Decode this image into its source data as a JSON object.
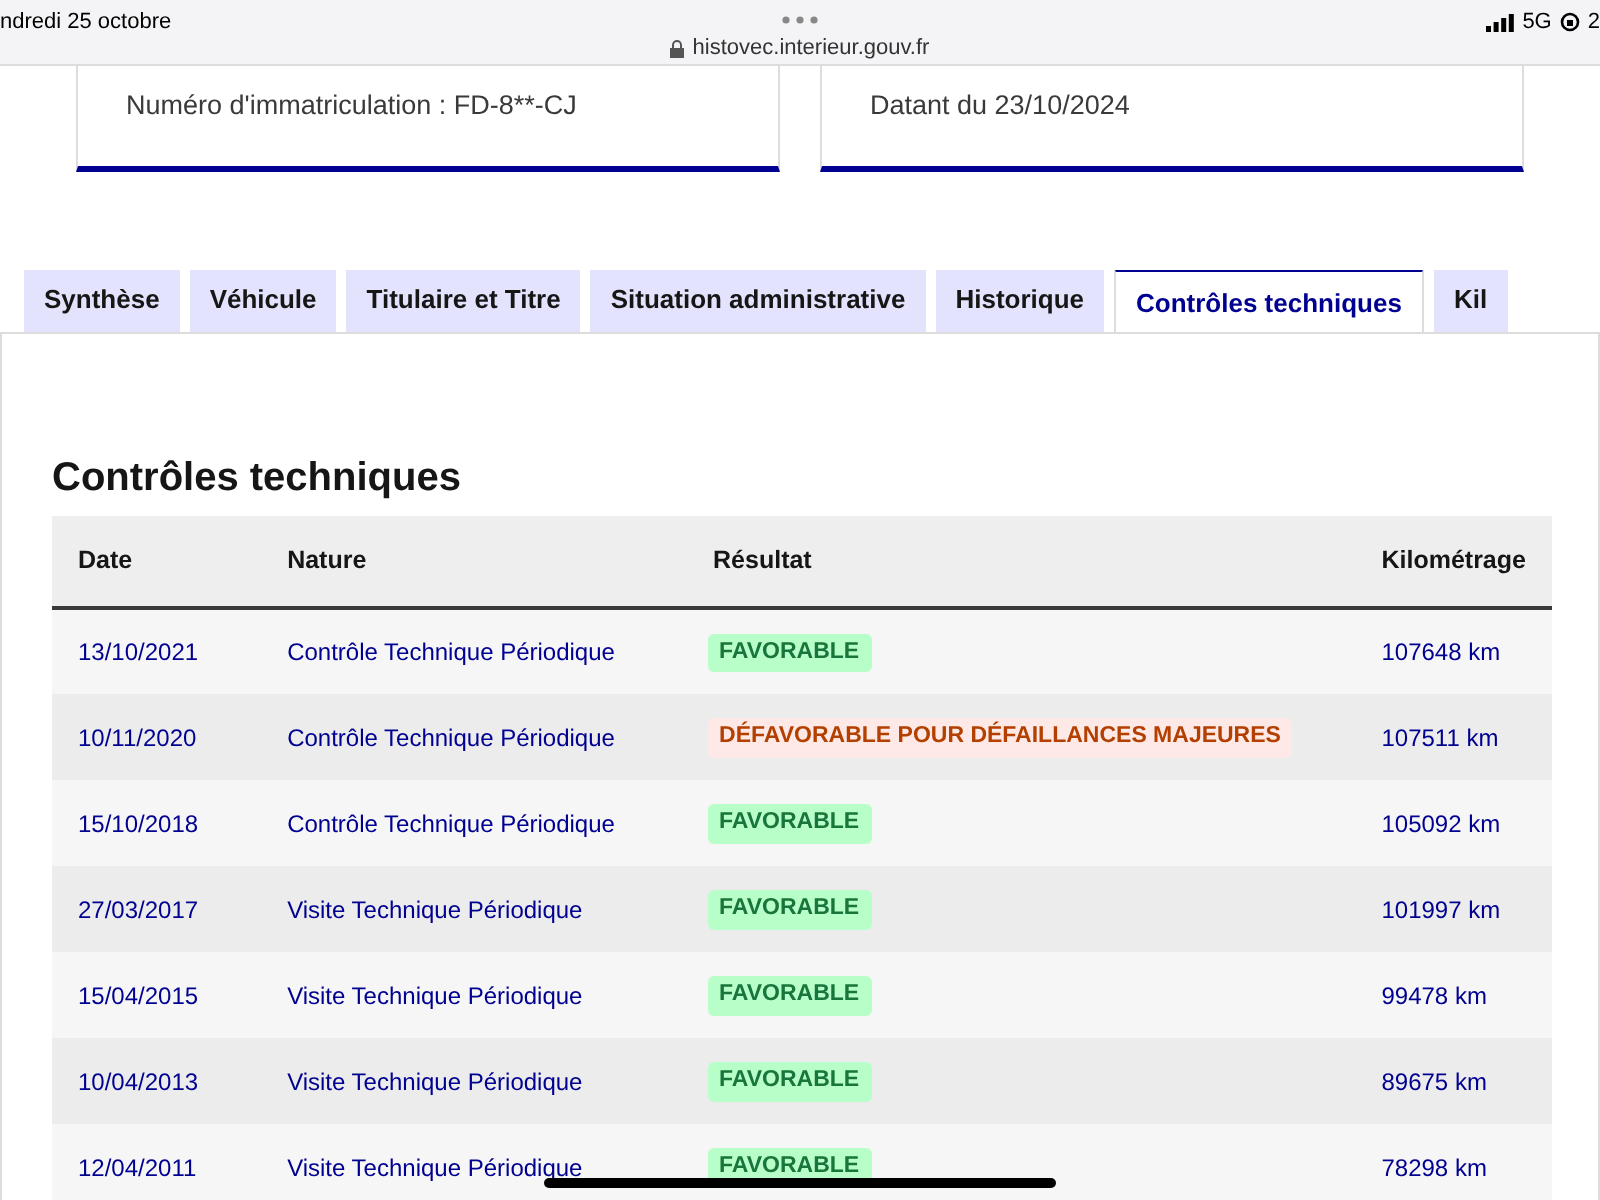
{
  "status_bar": {
    "date": "ndredi 25 octobre",
    "url": "histovec.interieur.gouv.fr",
    "network": "5G",
    "battery": "2"
  },
  "cards": [
    {
      "text": "Numéro d'immatriculation : FD-8**-CJ"
    },
    {
      "text": "Datant du 23/10/2024"
    }
  ],
  "tabs": [
    {
      "label": "Synthèse",
      "selected": false
    },
    {
      "label": "Véhicule",
      "selected": false
    },
    {
      "label": "Titulaire et Titre",
      "selected": false
    },
    {
      "label": "Situation administrative",
      "selected": false
    },
    {
      "label": "Historique",
      "selected": false
    },
    {
      "label": "Contrôles techniques",
      "selected": true
    },
    {
      "label": "Kil",
      "selected": false
    }
  ],
  "section_title": "Contrôles techniques",
  "table": {
    "columns": [
      "Date",
      "Nature",
      "Résultat",
      "Kilométrage"
    ],
    "rows": [
      {
        "date": "13/10/2021",
        "nature": "Contrôle Technique Périodique",
        "result": {
          "kind": "favorable",
          "label": "FAVORABLE"
        },
        "mileage": "107648 km"
      },
      {
        "date": "10/11/2020",
        "nature": "Contrôle Technique Périodique",
        "result": {
          "kind": "unfavorable",
          "label": "DÉFAVORABLE POUR DÉFAILLANCES MAJEURES"
        },
        "mileage": "107511 km"
      },
      {
        "date": "15/10/2018",
        "nature": "Contrôle Technique Périodique",
        "result": {
          "kind": "favorable",
          "label": "FAVORABLE"
        },
        "mileage": "105092 km"
      },
      {
        "date": "27/03/2017",
        "nature": "Visite Technique Périodique",
        "result": {
          "kind": "favorable",
          "label": "FAVORABLE"
        },
        "mileage": "101997 km"
      },
      {
        "date": "15/04/2015",
        "nature": "Visite Technique Périodique",
        "result": {
          "kind": "favorable",
          "label": "FAVORABLE"
        },
        "mileage": "99478 km"
      },
      {
        "date": "10/04/2013",
        "nature": "Visite Technique Périodique",
        "result": {
          "kind": "favorable",
          "label": "FAVORABLE"
        },
        "mileage": "89675 km"
      },
      {
        "date": "12/04/2011",
        "nature": "Visite Technique Périodique",
        "result": {
          "kind": "favorable",
          "label": "FAVORABLE"
        },
        "mileage": "78298 km"
      }
    ]
  }
}
